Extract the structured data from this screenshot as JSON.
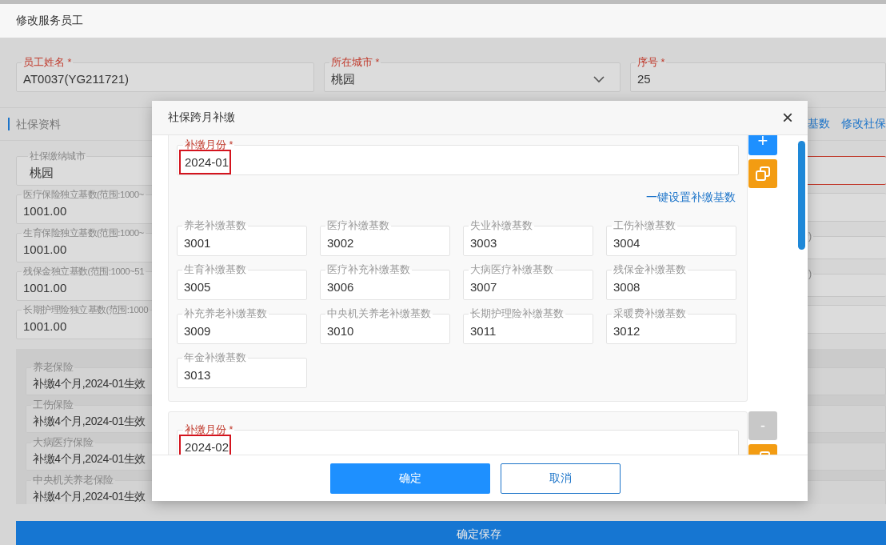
{
  "header": {
    "title": "修改服务员工"
  },
  "top_fields": [
    {
      "label": "员工姓名 *",
      "value": "AT0037(YG211721)",
      "kind": "text"
    },
    {
      "label": "所在城市 *",
      "value": "桃园",
      "kind": "select"
    },
    {
      "label": "序号 *",
      "value": "25",
      "kind": "text"
    }
  ],
  "section": {
    "title": "社保资料",
    "links": [
      "基数",
      "修改社保"
    ]
  },
  "left_fields": [
    {
      "label": "社保缴纳城市",
      "value": "桃园",
      "kind": "select"
    },
    {
      "label": "医疗保险独立基数(范围:1000~",
      "value": "1001.00",
      "kind": "text"
    },
    {
      "label": "生育保险独立基数(范围:1000~",
      "value": "1001.00",
      "kind": "text"
    },
    {
      "label": "残保金独立基数(范围:1000~51",
      "value": "1001.00",
      "kind": "text"
    },
    {
      "label": "长期护理险独立基数(范围:1000",
      "value": "1001.00",
      "kind": "text"
    }
  ],
  "right_fields": [
    {
      "error": true
    },
    {
      "error": false
    },
    {
      "label": ")",
      "error": false
    },
    {
      "label": ")",
      "error": false
    },
    {
      "error": false
    }
  ],
  "insurance_fields": [
    {
      "label": "养老保险",
      "value": "补缴4个月,2024-01生效"
    },
    {
      "label": "工伤保险",
      "value": "补缴4个月,2024-01生效"
    },
    {
      "label": "大病医疗保险",
      "value": "补缴4个月,2024-01生效"
    },
    {
      "label": "中央机关养老保险",
      "value": "补缴4个月,2024-01生效"
    }
  ],
  "save_button": "确定保存",
  "dialog": {
    "title": "社保跨月补缴",
    "close": "×",
    "entries": [
      {
        "month_label": "补缴月份 *",
        "month": "2024-01",
        "highlighted": true,
        "set_link": "一键设置补缴基数",
        "bases": [
          {
            "label": "养老补缴基数",
            "value": "3001"
          },
          {
            "label": "医疗补缴基数",
            "value": "3002"
          },
          {
            "label": "失业补缴基数",
            "value": "3003"
          },
          {
            "label": "工伤补缴基数",
            "value": "3004"
          },
          {
            "label": "生育补缴基数",
            "value": "3005"
          },
          {
            "label": "医疗补充补缴基数",
            "value": "3006"
          },
          {
            "label": "大病医疗补缴基数",
            "value": "3007"
          },
          {
            "label": "残保金补缴基数",
            "value": "3008"
          },
          {
            "label": "补充养老补缴基数",
            "value": "3009"
          },
          {
            "label": "中央机关养老补缴基数",
            "value": "3010"
          },
          {
            "label": "长期护理险补缴基数",
            "value": "3011"
          },
          {
            "label": "采暖费补缴基数",
            "value": "3012"
          },
          {
            "label": "年金补缴基数",
            "value": "3013"
          }
        ],
        "actions": [
          {
            "kind": "add",
            "symbol": "+"
          },
          {
            "kind": "copy"
          }
        ]
      },
      {
        "month_label": "补缴月份 *",
        "month": "2024-02",
        "highlighted": true,
        "actions": [
          {
            "kind": "remove",
            "symbol": "-"
          },
          {
            "kind": "copy"
          }
        ]
      }
    ],
    "buttons": [
      {
        "label": "确定",
        "kind": "primary"
      },
      {
        "label": "取消",
        "kind": "secondary"
      }
    ]
  }
}
